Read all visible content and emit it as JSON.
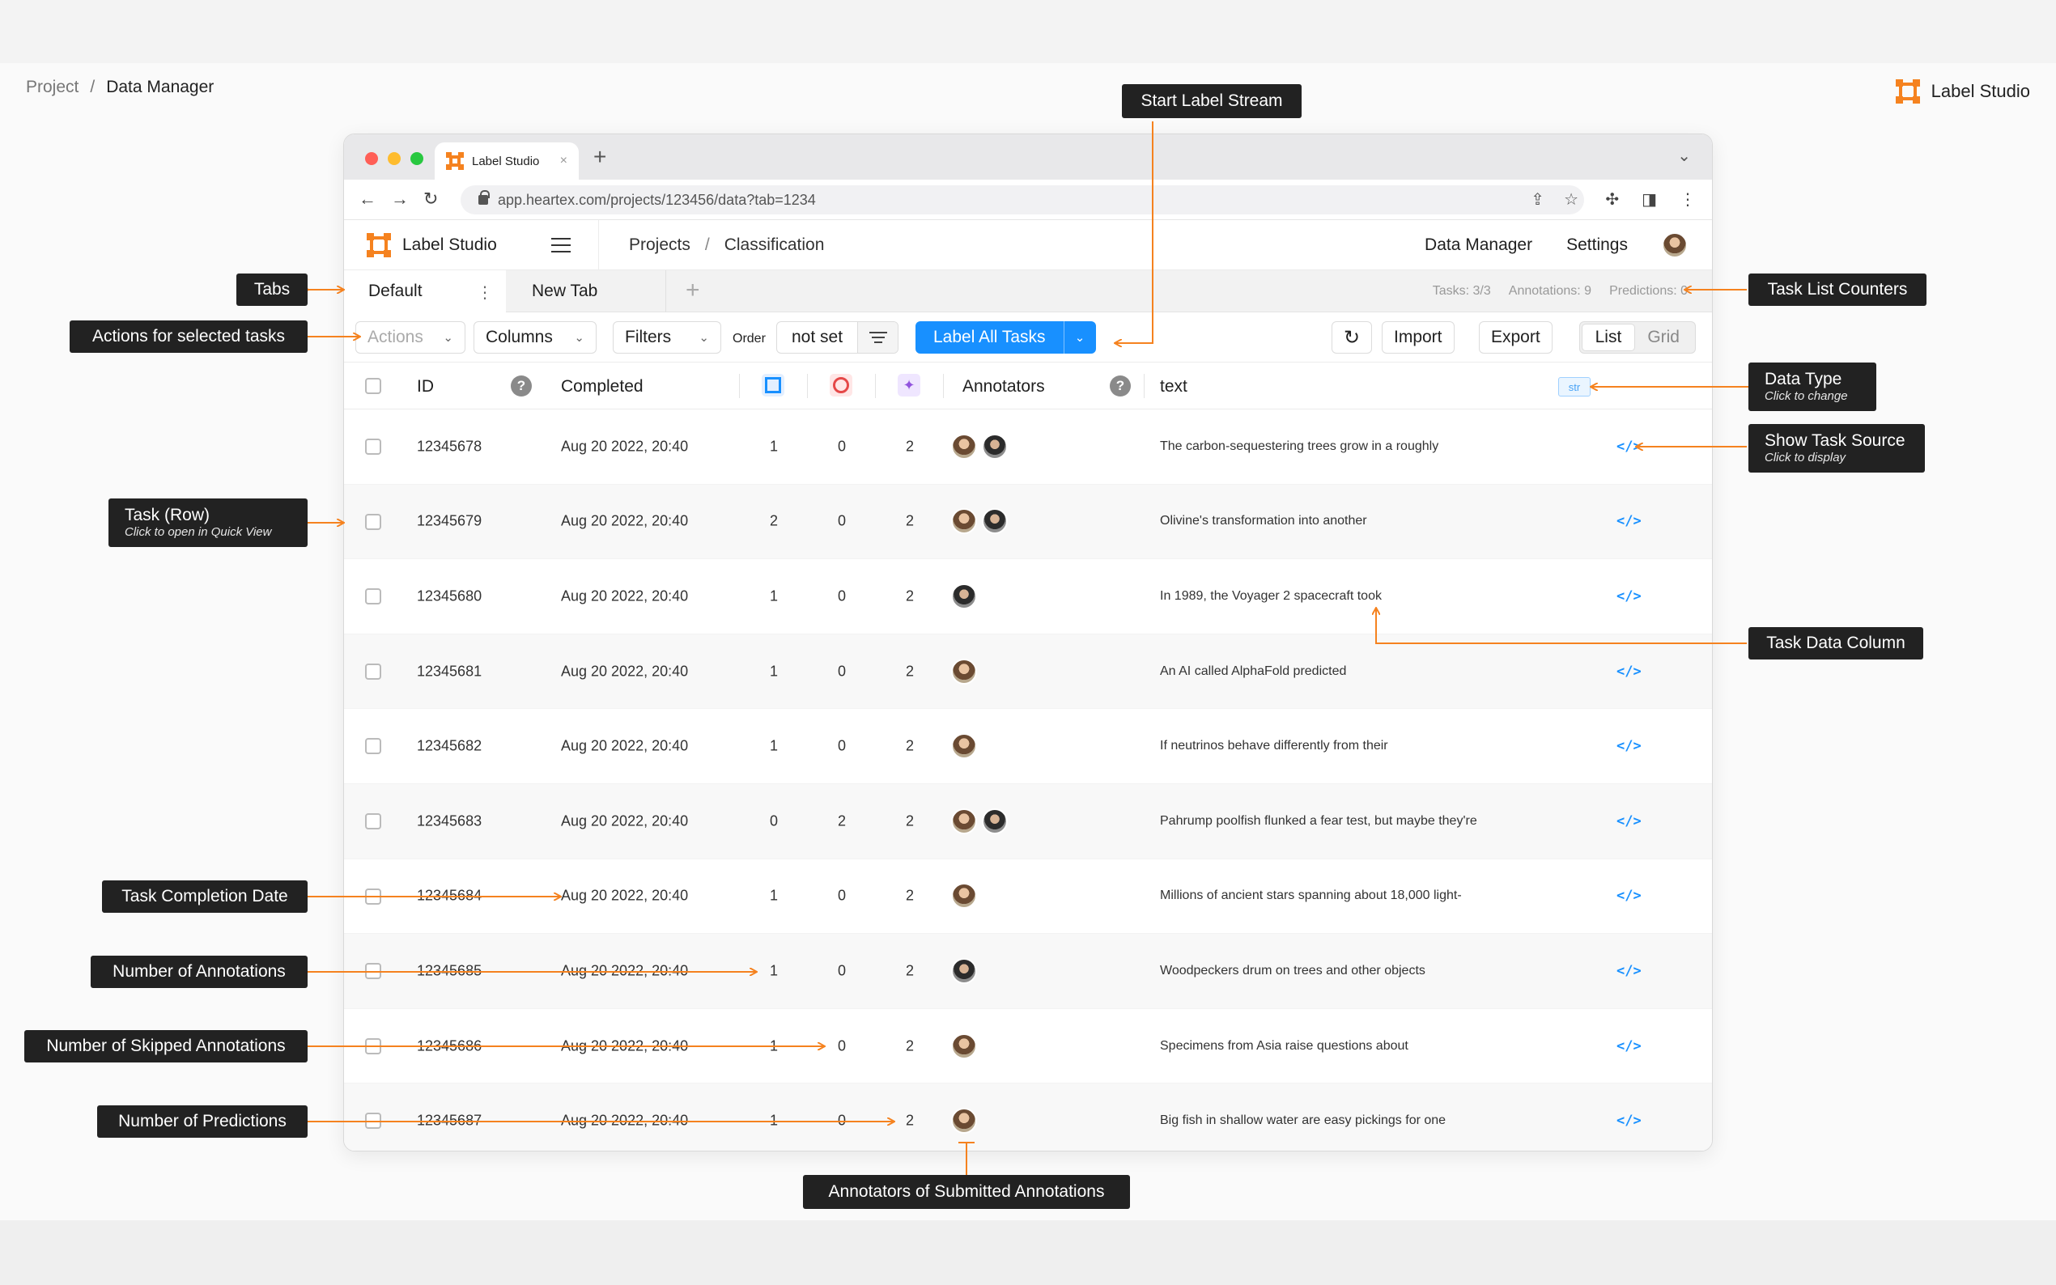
{
  "page": {
    "breadcrumb": [
      "Project",
      "Data Manager"
    ],
    "breadcrumb_sep": "/",
    "brand": "Label Studio"
  },
  "browser": {
    "tab_title": "Label Studio",
    "url": "app.heartex.com/projects/123456/data?tab=1234"
  },
  "app": {
    "brand": "Label Studio",
    "breadcrumb": [
      "Projects",
      "Classification"
    ],
    "breadcrumb_sep": "/",
    "nav": [
      "Data Manager",
      "Settings"
    ]
  },
  "tabs": {
    "items": [
      "Default",
      "New Tab"
    ],
    "counters": {
      "tasks": "Tasks: 3/3",
      "annotations": "Annotations: 9",
      "predictions": "Predictions: 0"
    }
  },
  "toolbar": {
    "actions": "Actions",
    "columns": "Columns",
    "filters": "Filters",
    "order_label": "Order",
    "order_value": "not set",
    "label_all": "Label All Tasks",
    "import": "Import",
    "export": "Export",
    "view_list": "List",
    "view_grid": "Grid"
  },
  "table": {
    "headers": {
      "id": "ID",
      "completed": "Completed",
      "annotators": "Annotators",
      "text": "text",
      "data_type": "str"
    },
    "rows": [
      {
        "id": "12345678",
        "completed": "Aug 20 2022, 20:40",
        "annotations": "1",
        "skipped": "0",
        "predictions": "2",
        "annotators": [
          "f",
          "m"
        ],
        "text": "The carbon-sequestering trees grow in a roughly"
      },
      {
        "id": "12345679",
        "completed": "Aug 20 2022, 20:40",
        "annotations": "2",
        "skipped": "0",
        "predictions": "2",
        "annotators": [
          "f",
          "m"
        ],
        "text": "Olivine's transformation into another"
      },
      {
        "id": "12345680",
        "completed": "Aug 20 2022, 20:40",
        "annotations": "1",
        "skipped": "0",
        "predictions": "2",
        "annotators": [
          "m"
        ],
        "text": "In 1989, the Voyager 2 spacecraft took"
      },
      {
        "id": "12345681",
        "completed": "Aug 20 2022, 20:40",
        "annotations": "1",
        "skipped": "0",
        "predictions": "2",
        "annotators": [
          "f"
        ],
        "text": "An AI called AlphaFold predicted"
      },
      {
        "id": "12345682",
        "completed": "Aug 20 2022, 20:40",
        "annotations": "1",
        "skipped": "0",
        "predictions": "2",
        "annotators": [
          "f"
        ],
        "text": "If neutrinos behave differently from their"
      },
      {
        "id": "12345683",
        "completed": "Aug 20 2022, 20:40",
        "annotations": "0",
        "skipped": "2",
        "predictions": "2",
        "annotators": [
          "f",
          "m"
        ],
        "text": "Pahrump poolfish flunked a fear test, but maybe they're"
      },
      {
        "id": "12345684",
        "completed": "Aug 20 2022, 20:40",
        "annotations": "1",
        "skipped": "0",
        "predictions": "2",
        "annotators": [
          "f"
        ],
        "text": "Millions of ancient stars spanning about 18,000 light-"
      },
      {
        "id": "12345685",
        "completed": "Aug 20 2022, 20:40",
        "annotations": "1",
        "skipped": "0",
        "predictions": "2",
        "annotators": [
          "m"
        ],
        "text": "Woodpeckers drum on trees and other objects"
      },
      {
        "id": "12345686",
        "completed": "Aug 20 2022, 20:40",
        "annotations": "1",
        "skipped": "0",
        "predictions": "2",
        "annotators": [
          "f"
        ],
        "text": "Specimens from Asia raise questions about"
      },
      {
        "id": "12345687",
        "completed": "Aug 20 2022, 20:40",
        "annotations": "1",
        "skipped": "0",
        "predictions": "2",
        "annotators": [
          "f"
        ],
        "text": "Big fish in shallow water are easy pickings for one"
      }
    ]
  },
  "callouts": {
    "start_label_stream": "Start Label Stream",
    "tabs": "Tabs",
    "task_list_counters": "Task List Counters",
    "actions_selected": "Actions for selected tasks",
    "data_type": "Data Type",
    "data_type_sub": "Click to change",
    "show_task_source": "Show Task Source",
    "show_task_source_sub": "Click to display",
    "task_row": "Task (Row)",
    "task_row_sub": "Click to open in Quick View",
    "task_data_column": "Task Data Column",
    "task_completion_date": "Task Completion Date",
    "number_of_annotations": "Number of Annotations",
    "number_of_skipped": "Number of Skipped Annotations",
    "number_of_predictions": "Number of Predictions",
    "annotators_submitted": "Annotators of Submitted Annotations"
  },
  "icons": {
    "logo": "label-studio-logo-icon",
    "kebab": "kebab-icon",
    "refresh": "refresh-icon",
    "code": "code-icon",
    "help": "help-icon"
  },
  "colors": {
    "accent": "#1890ff",
    "callout_arrow": "#f5821f",
    "callout_bg": "#222222"
  }
}
